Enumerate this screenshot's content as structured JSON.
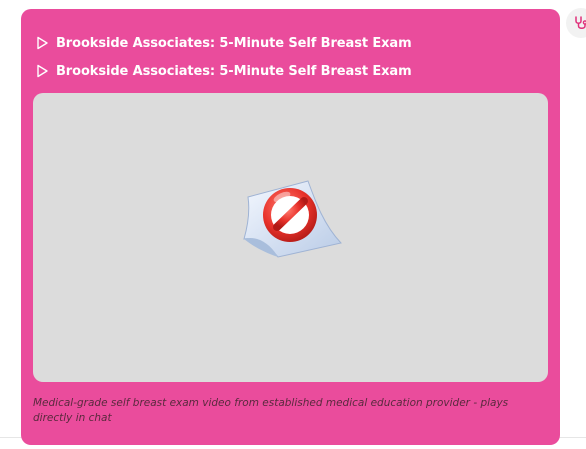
{
  "card": {
    "titles": [
      "Brookside Associates: 5-Minute Self Breast Exam",
      "Brookside Associates: 5-Minute Self Breast Exam"
    ],
    "caption": "Medical-grade self breast exam video from established medical education provider - plays directly in chat",
    "video": {
      "state_icon": "blocked-icon"
    }
  },
  "colors": {
    "card_background": "#ea4c9c",
    "video_background": "#dcdcdc",
    "accent": "#e0307a"
  },
  "icons": {
    "title_icon": "play-outline-icon",
    "side_icon": "stethoscope-icon"
  }
}
